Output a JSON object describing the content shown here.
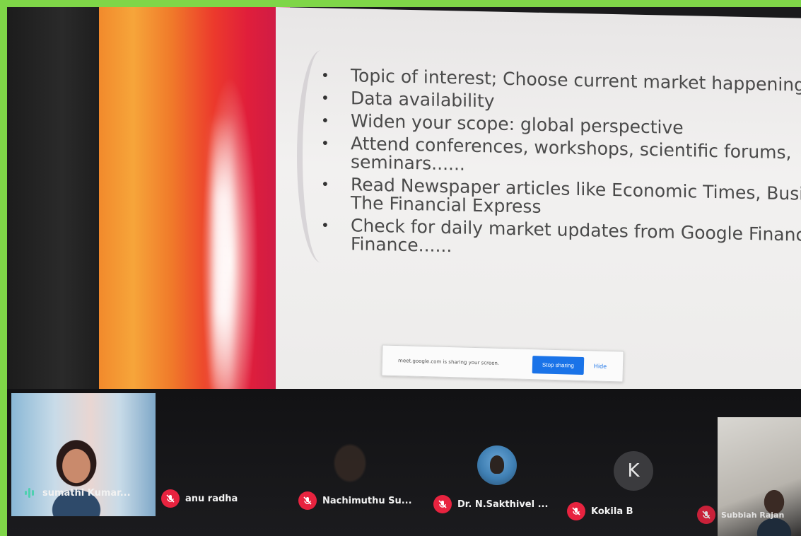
{
  "slide": {
    "bullets": [
      "Topic of interest; Choose current market happenings",
      "Data availability",
      "Widen your scope: global perspective",
      "Attend conferences, workshops, scientific forums, seminars......",
      "Read Newspaper articles like Economic Times, Busine The Financial Express",
      "Check for daily market updates from Google Finance, Finance......"
    ]
  },
  "share_bar": {
    "message": "meet.google.com is sharing your screen.",
    "stop_label": "Stop sharing",
    "hide_label": "Hide"
  },
  "participants": [
    {
      "name": "sumathi Kumar...",
      "status": "speaking"
    },
    {
      "name": "anu radha",
      "status": "muted"
    },
    {
      "name": "Nachimuthu Su...",
      "status": "muted"
    },
    {
      "name": "Dr. N.Sakthivel ...",
      "status": "muted"
    },
    {
      "name": "Kokila B",
      "status": "muted",
      "initial": "K"
    },
    {
      "name": "Subbiah Rajan",
      "status": "muted"
    }
  ],
  "colors": {
    "border": "#7fd648",
    "mute": "#e8233f",
    "accent": "#1a73e8",
    "speaking": "#4fd0b0"
  }
}
